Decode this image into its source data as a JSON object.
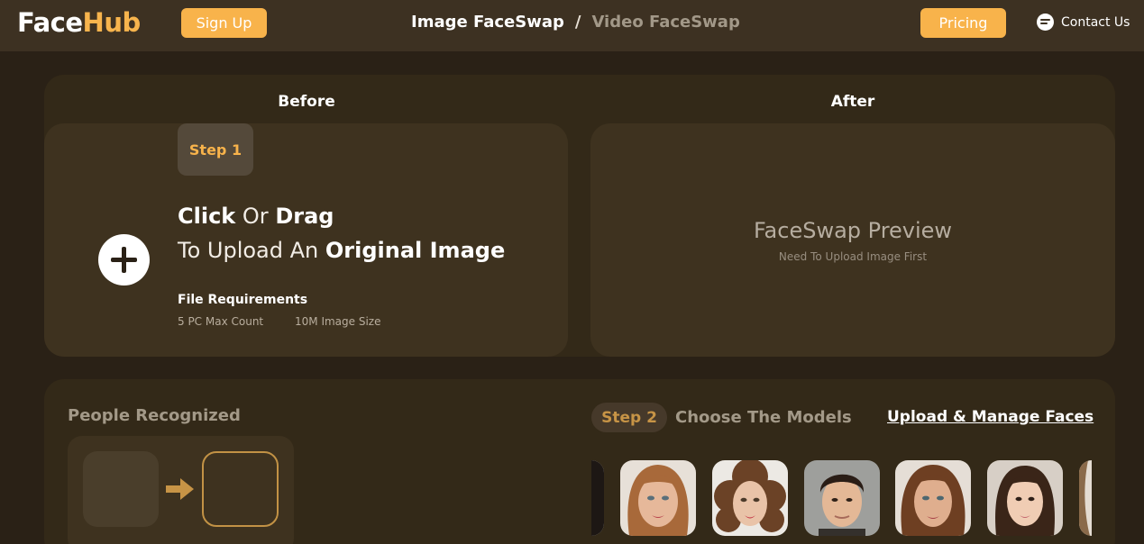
{
  "header": {
    "logo_face": "Face",
    "logo_hub": "Hub",
    "signup_label": "Sign Up",
    "nav_image": "Image FaceSwap",
    "nav_sep": "/",
    "nav_video": "Video FaceSwap",
    "pricing_label": "Pricing",
    "contact_label": "Contact Us",
    "contact_icon": "chat-icon"
  },
  "main": {
    "before_title": "Before",
    "after_title": "After",
    "step1_label": "Step 1",
    "upload_click": "Click",
    "upload_or": "Or",
    "upload_drag": "Drag",
    "upload_to": "To Upload An",
    "upload_original": "Original Image",
    "plus_icon": "plus-icon",
    "req_title": "File Requirements",
    "req_count": "5 PC Max Count",
    "req_size": "10M Image Size",
    "preview_title": "FaceSwap Preview",
    "preview_sub": "Need To Upload Image First"
  },
  "bottom": {
    "people_title": "People Recognized",
    "arrow_icon": "arrow-right-icon",
    "step2_label": "Step 2",
    "choose_models": "Choose The Models",
    "manage_faces": "Upload & Manage Faces",
    "models": [
      {
        "name": "model-partial-left"
      },
      {
        "name": "model-woman-blonde"
      },
      {
        "name": "model-woman-curly"
      },
      {
        "name": "model-man"
      },
      {
        "name": "model-woman-auburn"
      },
      {
        "name": "model-woman-asian"
      },
      {
        "name": "model-partial-right"
      }
    ]
  },
  "colors": {
    "background": "#2a2116",
    "header": "#3d3122",
    "panel": "#332918",
    "card": "#3e321f",
    "accent": "#f8b34b"
  }
}
